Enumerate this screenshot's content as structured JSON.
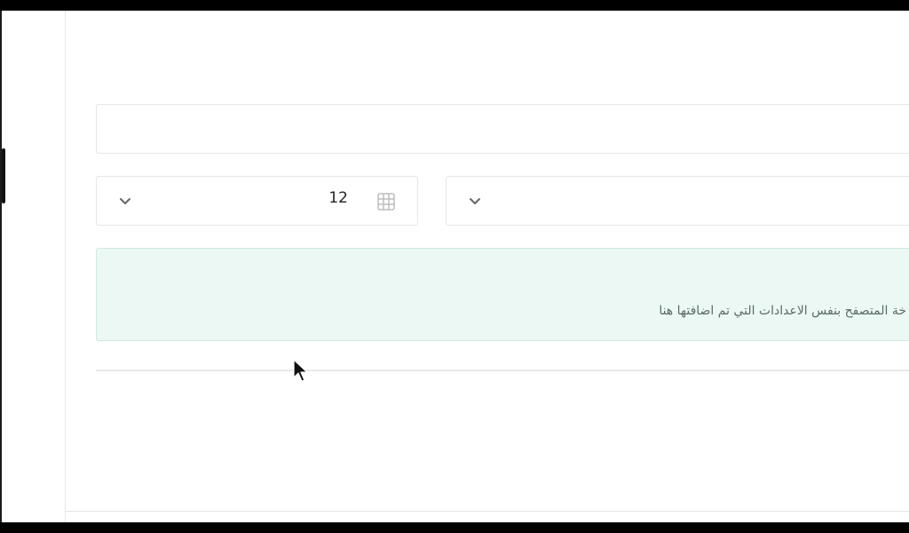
{
  "form": {
    "text_field_value": "",
    "select_count": {
      "value": "12",
      "icon": "grid-icon",
      "arrow": "chevron-down-icon"
    },
    "select_other": {
      "value": "",
      "arrow": "chevron-down-icon"
    }
  },
  "notice": {
    "text": "خة المتصفح بنفس الاعدادات التي تم اضافتها هنا"
  },
  "colors": {
    "notice_bg": "#ebf8f3",
    "border": "#e6e6e6"
  }
}
